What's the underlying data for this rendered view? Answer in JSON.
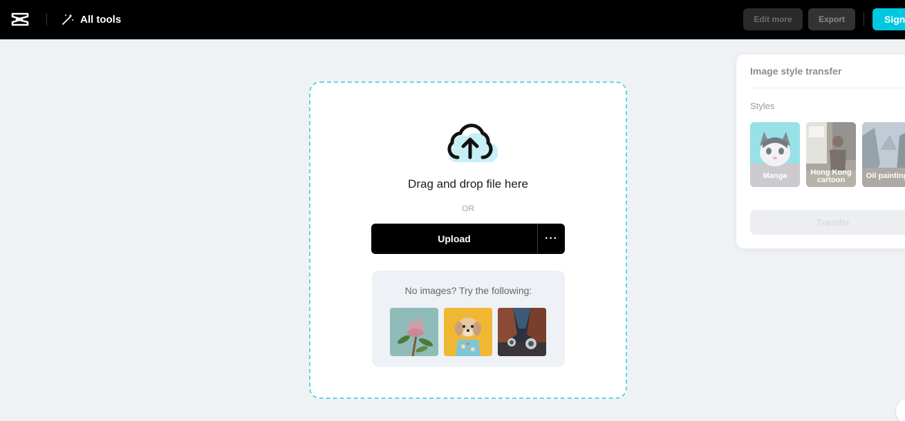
{
  "header": {
    "logo_icon": "capcut-logo-icon",
    "all_tools_icon": "magic-wand-icon",
    "all_tools_label": "All tools",
    "edit_more_label": "Edit more",
    "export_label": "Export",
    "sign_in_label": "Sign",
    "accent_color": "#00c8e0"
  },
  "upload": {
    "cloud_icon": "cloud-upload-icon",
    "drag_text": "Drag and drop file here",
    "or_text": "OR",
    "upload_label": "Upload",
    "more_label": "···",
    "samples_title": "No images? Try the following:",
    "samples": [
      {
        "icon": "protea-flower-image"
      },
      {
        "icon": "puppy-in-shirt-image"
      },
      {
        "icon": "canyon-car-image"
      }
    ]
  },
  "panel": {
    "title": "Image style transfer",
    "styles_label": "Styles",
    "styles": [
      {
        "label": "Manga"
      },
      {
        "label": "Hong Kong cartoon"
      },
      {
        "label": "Oil painting"
      }
    ],
    "transfer_label": "Transfer"
  }
}
